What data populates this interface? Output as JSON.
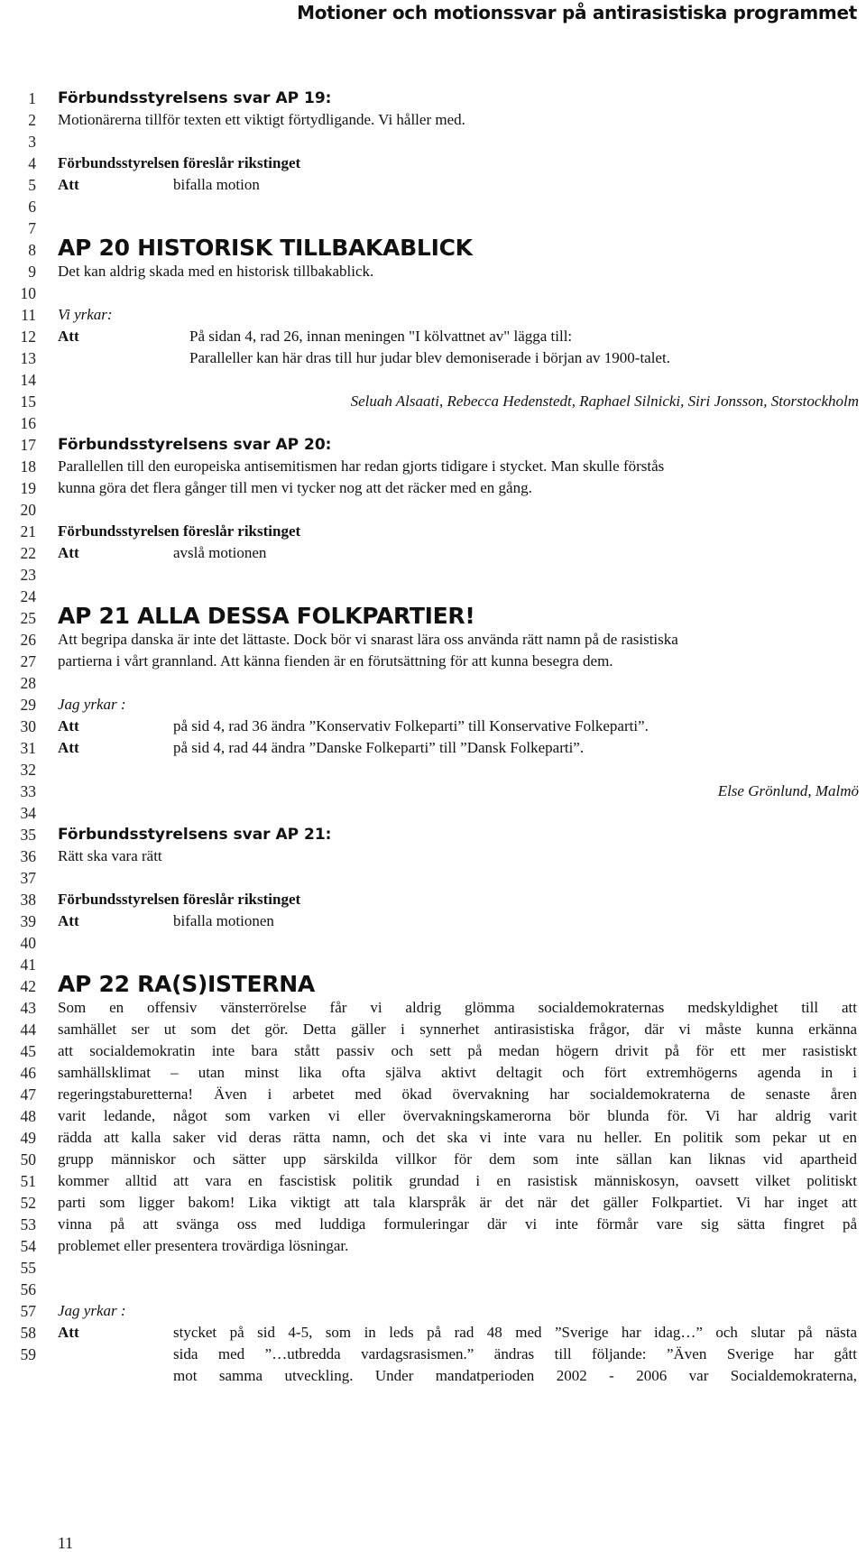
{
  "header": {
    "title": "Motioner och motionssvar på antirasistiska programmet"
  },
  "line_numbers": [
    "1",
    "2",
    "3",
    "4",
    "5",
    "6",
    "7",
    "8",
    "9",
    "10",
    "11",
    "12",
    "13",
    "14",
    "15",
    "16",
    "17",
    "18",
    "19",
    "20",
    "21",
    "22",
    "23",
    "24",
    "25",
    "26",
    "27",
    "28",
    "29",
    "30",
    "31",
    "32",
    "33",
    "34",
    "35",
    "36",
    "37",
    "38",
    "39",
    "40",
    "41",
    "42",
    "43",
    "44",
    "45",
    "46",
    "47",
    "48",
    "49",
    "50",
    "51",
    "52",
    "53",
    "54",
    "55",
    "56",
    "57",
    "58",
    "59"
  ],
  "ap19_response": {
    "heading": "Förbundsstyrelsens svar AP 19:",
    "body": "Motionärerna tillför texten ett viktigt förtydligande. Vi håller med.",
    "proposal_label": "Förbundsstyrelsen föreslår rikstinget",
    "att_label": "Att",
    "att_text": "bifalla motion"
  },
  "ap20": {
    "heading": "AP 20 HISTORISK TILLBAKABLICK",
    "body": "Det kan aldrig skada med en historisk tillbakablick.",
    "claim_label": "Vi yrkar:",
    "att_label": "Att",
    "att_line1": "På sidan 4, rad 26, innan meningen \"I kölvattnet av\" lägga till:",
    "att_line2": "Paralleller kan här dras till hur judar blev demoniserade i början av 1900-talet.",
    "signature": "Seluah Alsaati, Rebecca Hedenstedt, Raphael Silnicki, Siri Jonsson, Storstockholm"
  },
  "ap20_response": {
    "heading": "Förbundsstyrelsens svar AP 20:",
    "body_line1": "Parallellen till den europeiska antisemitismen har redan gjorts tidigare i stycket. Man skulle förstås",
    "body_line2": "kunna göra det flera gånger till men vi tycker nog att det räcker med en gång.",
    "proposal_label": "Förbundsstyrelsen föreslår rikstinget",
    "att_label": "Att",
    "att_text": "avslå motionen"
  },
  "ap21": {
    "heading": "AP 21 ALLA DESSA FOLKPARTIER!",
    "body_line1": "Att begripa danska är inte det lättaste. Dock bör vi snarast lära oss använda rätt namn på de rasistiska",
    "body_line2": "partierna i vårt grannland. Att känna fienden är en förutsättning för att kunna besegra dem.",
    "claim_label": "Jag yrkar :",
    "att_label": "Att",
    "att1_text": "på sid 4, rad 36 ändra ”Konservativ Folkeparti” till Konservative Folkeparti”.",
    "att2_text": "på sid 4, rad 44 ändra ”Danske Folkeparti” till ”Dansk Folkeparti”.",
    "signature": "Else Grönlund, Malmö"
  },
  "ap21_response": {
    "heading": "Förbundsstyrelsens svar AP 21:",
    "body": "Rätt ska vara rätt",
    "proposal_label": "Förbundsstyrelsen föreslår rikstinget",
    "att_label": "Att",
    "att_text": "bifalla motionen"
  },
  "ap22": {
    "heading": "AP 22 RA(S)ISTERNA",
    "body_lines": [
      "Som en offensiv vänsterrörelse får vi aldrig glömma socialdemokraternas medskyldighet till att",
      "samhället ser ut som det gör. Detta gäller i synnerhet antirasistiska frågor, där vi måste kunna erkänna",
      "att socialdemokratin inte bara stått passiv och sett på medan högern drivit på för ett mer rasistiskt",
      "samhällsklimat – utan minst lika ofta själva aktivt deltagit och fört extremhögerns agenda in i",
      "regeringstaburetterna! Även i arbetet med ökad övervakning har socialdemokraterna de senaste åren",
      "varit ledande, något som varken vi eller övervakningskamerorna bör blunda för. Vi har aldrig varit",
      "rädda att kalla saker vid deras rätta namn, och det ska vi inte vara nu heller. En politik som pekar ut en",
      "grupp människor och sätter upp särskilda villkor för dem som inte sällan kan liknas vid apartheid",
      "kommer alltid att vara en fascistisk politik grundad i en rasistisk människosyn, oavsett vilket politiskt",
      "parti som ligger bakom! Lika viktigt att tala klarspråk är det när det gäller Folkpartiet. Vi har inget att",
      "vinna på att svänga oss med luddiga formuleringar där vi inte förmår vare sig sätta fingret på",
      "problemet eller presentera trovärdiga lösningar."
    ],
    "claim_label": "Jag yrkar :",
    "att_label": "Att",
    "att_lines": [
      "stycket på sid 4-5, som in leds på rad 48 med ”Sverige har idag…” och slutar på nästa",
      "sida med ”…utbredda vardagsrasismen.” ändras till följande: ”Även Sverige har gått",
      "mot samma utveckling. Under mandatperioden 2002 - 2006 var Socialdemokraterna,"
    ]
  },
  "footer": {
    "page_number": "11"
  }
}
